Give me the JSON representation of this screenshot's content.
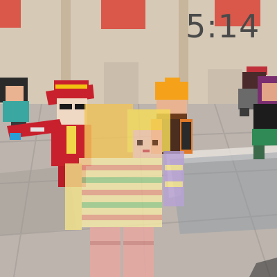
{
  "hud": {
    "timer": "5:14"
  },
  "scene": {
    "characters": [
      {
        "name": "player-blonde-striped-shirt",
        "hair": "#f4d64a",
        "shirt": "#f2d46a"
      },
      {
        "name": "npc-red-hat-suit",
        "hat": "#c8202c",
        "suit": "#c8202c"
      },
      {
        "name": "npc-orange-hardhat",
        "hat": "#f5a21a",
        "vest": "#e07a2a"
      },
      {
        "name": "npc-teal-left",
        "shirt": "#3aa7a0"
      },
      {
        "name": "npc-red-cap-right",
        "cap": "#c0303a"
      },
      {
        "name": "npc-purple-green-right",
        "shirt": "#7a2e6f",
        "pants": "#2f8a55"
      }
    ],
    "colors": {
      "wall": "#d4c7b5",
      "floor": "#b9b1aa",
      "floor_shadow": "#8f9aa2",
      "banner": "#d9584a",
      "pillar": "#c9b79f"
    }
  }
}
